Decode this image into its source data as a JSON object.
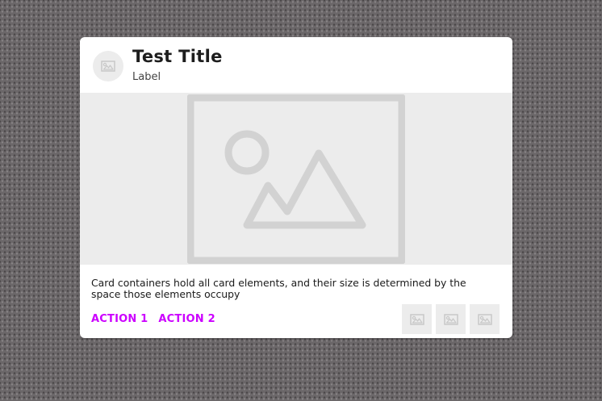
{
  "card": {
    "title": "Test Title",
    "subtitle": "Label",
    "body": "Card containers hold all card elements, and their size is determined by the space those elements occupy",
    "actions": [
      {
        "label": "ACTION 1"
      },
      {
        "label": "ACTION 2"
      }
    ],
    "icon_buttons": [
      "image-icon",
      "image-icon",
      "image-icon"
    ],
    "avatar_icon": "image-icon",
    "media_icon": "image-placeholder-icon"
  },
  "colors": {
    "accent": "#cc00ff",
    "card_background": "#ffffff",
    "placeholder_gray": "#ececec",
    "placeholder_stroke": "#d2d2d2",
    "title_text": "#1d1d1d",
    "background": "#6b6769"
  }
}
